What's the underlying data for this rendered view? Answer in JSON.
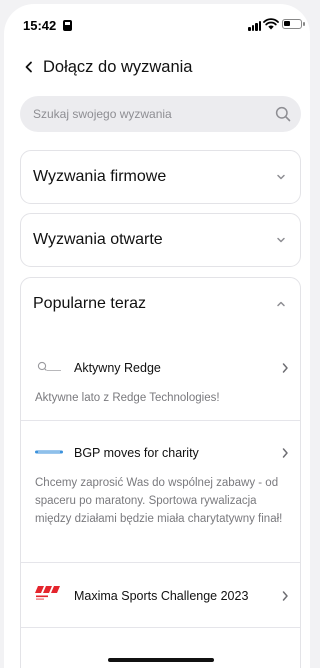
{
  "status_bar": {
    "time": "15:42"
  },
  "header": {
    "title": "Dołącz do wyzwania"
  },
  "search": {
    "placeholder": "Szukaj swojego wyzwania",
    "value": ""
  },
  "sections": {
    "company": {
      "title": "Wyzwania firmowe",
      "expanded": false
    },
    "open": {
      "title": "Wyzwania otwarte",
      "expanded": false
    },
    "popular": {
      "title": "Popularne teraz",
      "expanded": true,
      "items": [
        {
          "title": "Aktywny Redge",
          "description": "Aktywne lato z Redge Technologies!",
          "logo": "redge-logo"
        },
        {
          "title": "BGP moves for charity",
          "description": "Chcemy zaprosić Was do wspólnej zabawy - od spaceru po maratony. Sportowa rywalizacja między działami będzie miała charytatywny finał!",
          "logo": "bgp-logo"
        },
        {
          "title": "Maxima Sports Challenge 2023",
          "description": "",
          "logo": "maxima-logo"
        }
      ]
    }
  },
  "colors": {
    "maxima_red": "#e4252d",
    "bgp_blue": "#1a7fd6",
    "muted_text": "#7a7a7e"
  }
}
